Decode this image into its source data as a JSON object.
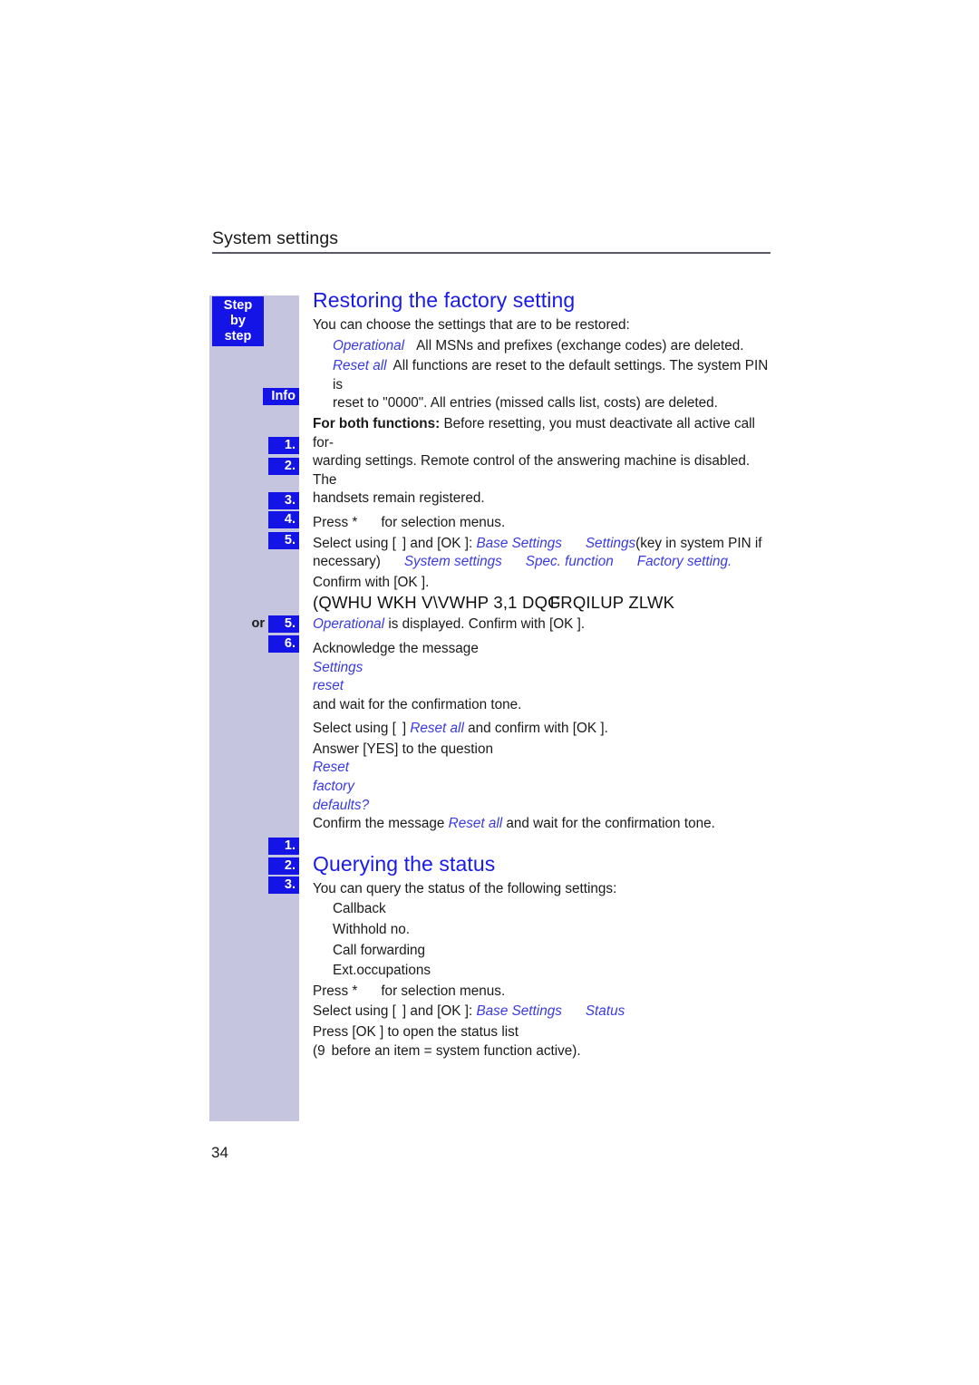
{
  "running_head": {
    "title": "System settings"
  },
  "sidebar": {
    "step_badge": {
      "line1": "Step",
      "line2": "by",
      "line3": "step"
    },
    "markers": {
      "info": "Info",
      "s1": "1.",
      "s2": "2.",
      "s3": "3.",
      "s4": "4.",
      "s5": "5.",
      "or": "or",
      "s5b": "5.",
      "s6": "6.",
      "q1": "1.",
      "q2": "2.",
      "q3": "3."
    }
  },
  "sections": {
    "restoring": {
      "title": "Restoring the factory setting",
      "intro": "You can choose the settings that are to be restored:",
      "option_operational_name": "Operational",
      "option_operational_desc": "All MSNs and prefixes (exchange codes) are deleted.",
      "option_reset_all_name": "Reset all",
      "option_reset_all_desc_line1": "All functions are reset to the default settings. The system PIN is",
      "option_reset_all_desc_line2": "reset to \"0000\". All entries (missed calls list, costs) are deleted.",
      "info_lead": "For both functions:",
      "info_line1": "Before resetting, you must deactivate all active call for-",
      "info_line2": "warding settings. Remote control of the answering machine is disabled. The",
      "info_line3": "handsets remain registered.",
      "step1": "Press *",
      "step1_tail": "for selection menus.",
      "step2_lead": "Select using [",
      "step2_mid": "] and [OK ]:",
      "step2_path1": "Base Settings",
      "step2_path2": "Settings",
      "step2_paren": "(key in system PIN if",
      "step2_line2_lead": "necessary)",
      "step2_path3": "System settings",
      "step2_path4": "Spec. function",
      "step2_path5": "Factory setting.",
      "step3": "Confirm with [OK ].",
      "step4_garbled_a": "(QWHU WKH V\\VWHP 3,1 DQG",
      "step4_garbled_b": "FRQILUP ZLWK",
      "step5_name": "Operational",
      "step5_tail": "is displayed. Confirm with [OK ].",
      "ack_line": "Acknowledge the message",
      "ack_msg1": "Settings",
      "ack_msg2": "reset",
      "ack_tail": "and wait for the confirmation tone.",
      "step5b_lead": "Select using [",
      "step5b_mid": "]",
      "step5b_name": "Reset all",
      "step5b_tail": "and confirm with [OK ].",
      "step6_lead": "Answer [YES] to the question",
      "step6_msg1": "Reset",
      "step6_msg2": "factory",
      "step6_msg3": "defaults?",
      "step6_confirm_lead": "Confirm the message",
      "step6_confirm_name": "Reset all",
      "step6_confirm_tail": "and wait for the confirmation tone."
    },
    "querying": {
      "title": "Querying the status",
      "intro": "You can query the status of the following settings:",
      "items": [
        "Callback",
        "Withhold no.",
        "Call forwarding",
        "Ext.occupations"
      ],
      "step1": "Press *",
      "step1_tail": "for selection menus.",
      "step2_lead": "Select using [",
      "step2_mid": "] and [OK ]:",
      "step2_path1": "Base Settings",
      "step2_path2": "Status",
      "step3_line1": "Press [OK ] to open the status list",
      "step3_line2_lead": "(9",
      "step3_line2_tail": "before an item = system function active)."
    }
  },
  "footer": {
    "page_number": "34"
  },
  "colors": {
    "heading_blue": "#1a1ae8",
    "chip_blue": "#1414e6",
    "sidebar_lilac": "#c5c5e0",
    "italic_blue": "#3a3ae0"
  }
}
